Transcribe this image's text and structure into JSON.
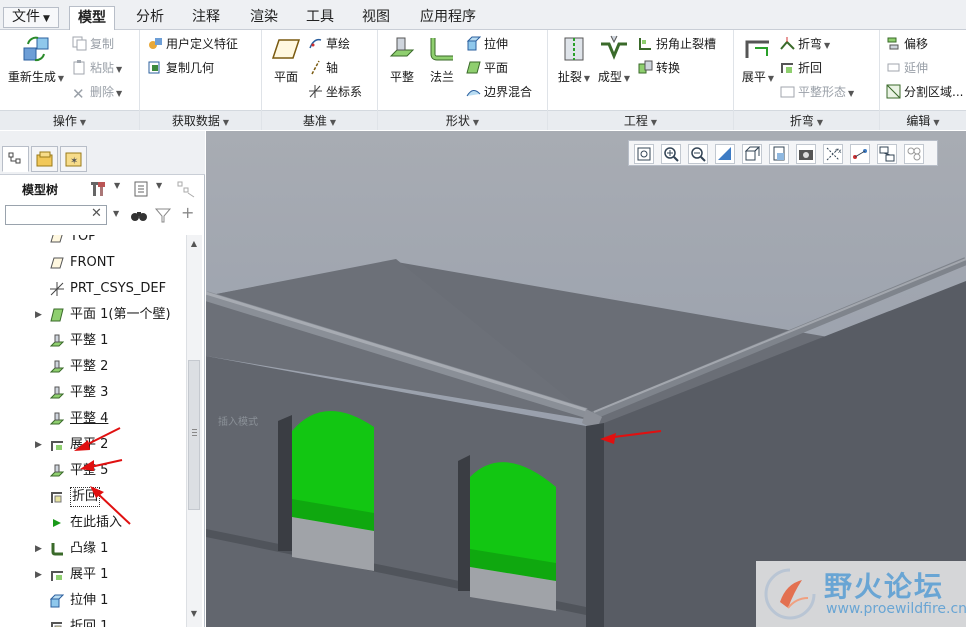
{
  "menu": {
    "tabs": [
      "文件",
      "模型",
      "分析",
      "注释",
      "渲染",
      "工具",
      "视图",
      "应用程序"
    ],
    "active": "模型"
  },
  "ribbon": {
    "operations": {
      "label": "操作",
      "regenerate": "重新生成",
      "copy": "复制",
      "paste": "粘贴",
      "delete": "删除"
    },
    "get_data": {
      "label": "获取数据",
      "udf": "用户定义特征",
      "copy_geometry": "复制几何"
    },
    "datum": {
      "label": "基准",
      "plane": "平面",
      "sketch": "草绘",
      "axis": "轴",
      "csys": "坐标系"
    },
    "shapes": {
      "label": "形状",
      "flat": "平整",
      "flange": "法兰",
      "extrude": "拉伸",
      "planar": "平面",
      "blend": "边界混合"
    },
    "engineering": {
      "label": "工程",
      "rip": "扯裂",
      "form": "成型",
      "corner_relief": "拐角止裂槽",
      "convert": "转换"
    },
    "bends": {
      "label": "折弯",
      "unbend": "展平",
      "bend": "折弯",
      "bend_back": "折回",
      "flat_state": "平整形态"
    },
    "editing": {
      "label": "编辑",
      "offset": "偏移",
      "extend": "延伸",
      "split_area": "分割区域..."
    }
  },
  "panel": {
    "title": "模型树",
    "search_placeholder": "",
    "tree": [
      {
        "label": "TOP",
        "icon": "datum-plane-icon",
        "expandable": false,
        "indent": 1
      },
      {
        "label": "FRONT",
        "icon": "datum-plane-icon",
        "expandable": false,
        "indent": 1
      },
      {
        "label": "PRT_CSYS_DEF",
        "icon": "csys-icon",
        "expandable": false,
        "indent": 1
      },
      {
        "label": "平面 1(第一个壁)",
        "icon": "planar-wall-icon",
        "expandable": true,
        "indent": 1
      },
      {
        "label": "平整 1",
        "icon": "flat-wall-icon",
        "expandable": false,
        "indent": 1
      },
      {
        "label": "平整 2",
        "icon": "flat-wall-icon",
        "expandable": false,
        "indent": 1
      },
      {
        "label": "平整 3",
        "icon": "flat-wall-icon",
        "expandable": false,
        "indent": 1
      },
      {
        "label": "平整 4",
        "icon": "flat-wall-icon",
        "expandable": false,
        "indent": 1
      },
      {
        "label": "展平 2",
        "icon": "unbend-icon",
        "expandable": true,
        "indent": 1
      },
      {
        "label": "平整 5",
        "icon": "flat-wall-icon",
        "expandable": false,
        "indent": 1
      },
      {
        "label": "折回",
        "icon": "bend-back-icon",
        "expandable": false,
        "indent": 1
      },
      {
        "label": "在此插入",
        "icon": "insert-here-icon",
        "expandable": false,
        "indent": 1
      },
      {
        "label": "凸缘 1",
        "icon": "flange-icon",
        "expandable": true,
        "indent": 1
      },
      {
        "label": "展平 1",
        "icon": "unbend-icon",
        "expandable": true,
        "indent": 1
      },
      {
        "label": "拉伸 1",
        "icon": "extrude-icon",
        "expandable": false,
        "indent": 1
      },
      {
        "label": "折回 1",
        "icon": "bend-back-icon",
        "expandable": false,
        "indent": 1
      }
    ]
  },
  "viewport": {
    "ghost_label": "插入模式",
    "watermark_title": "野火论坛",
    "watermark_url": "www.proewildfire.cn"
  },
  "colors": {
    "accent_green": "#11c511",
    "arrow_red": "#e01010",
    "model_gray": "#5a5e66",
    "ribbon_bg": "#ffffff",
    "panel_bg": "#eef0f3"
  }
}
